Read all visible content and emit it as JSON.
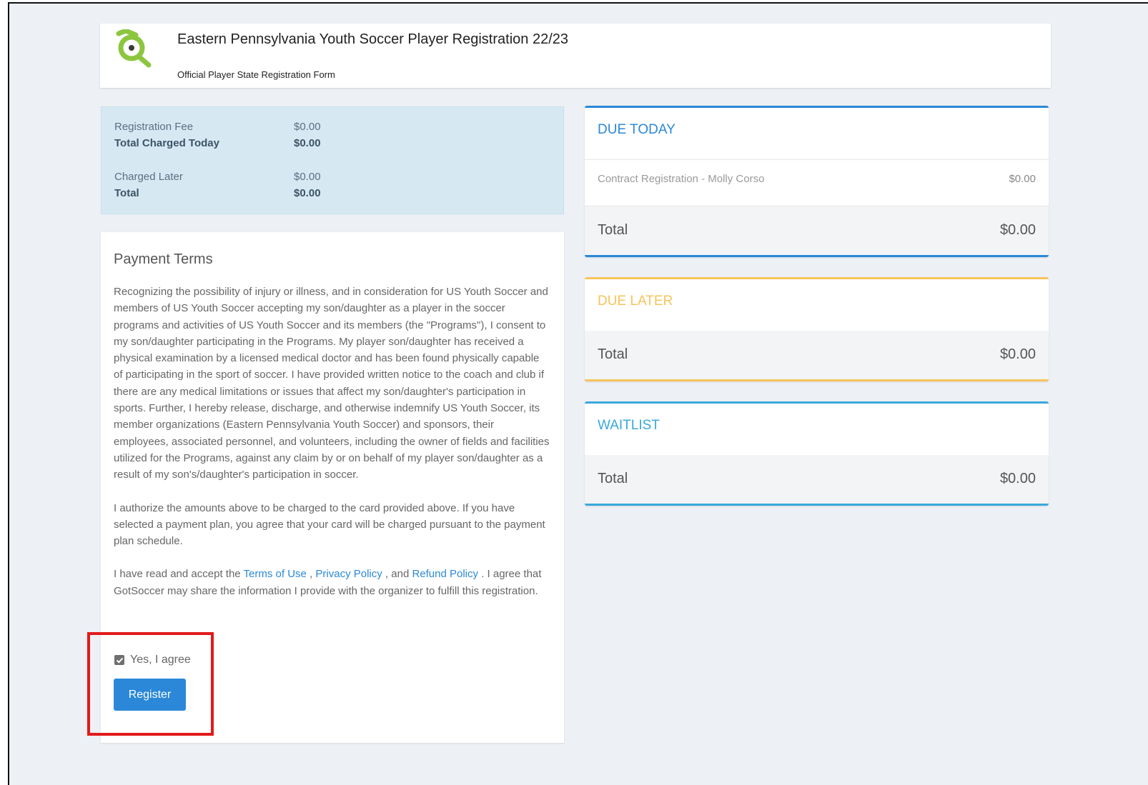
{
  "header": {
    "title": "Eastern Pennsylvania Youth Soccer Player Registration 22/23",
    "subtitle": "Official Player State Registration Form",
    "logo_icon": "gotsoccer-logo"
  },
  "summary": {
    "registration_fee_label": "Registration Fee",
    "registration_fee_value": "$0.00",
    "total_today_label": "Total Charged Today",
    "total_today_value": "$0.00",
    "charged_later_label": "Charged Later",
    "charged_later_value": "$0.00",
    "total_label": "Total",
    "total_value": "$0.00"
  },
  "terms": {
    "title": "Payment Terms",
    "paragraph1": "Recognizing the possibility of injury or illness, and in consideration for US Youth Soccer and members of US Youth Soccer accepting my son/daughter as a player in the soccer programs and activities of US Youth Soccer and its members (the \"Programs\"), I consent to my son/daughter participating in the Programs. My player son/daughter has received a physical examination by a licensed medical doctor and has been found physically capable of participating in the sport of soccer. I have provided written notice to the coach and club if there are any medical limitations or issues that affect my son/daughter's participation in sports. Further, I hereby release, discharge, and otherwise indemnify US Youth Soccer, its member organizations (Eastern Pennsylvania Youth Soccer) and sponsors, their employees, associated personnel, and volunteers, including the owner of fields and facilities utilized for the Programs, against any claim by or on behalf of my player son/daughter as a result of my son's/daughter's participation in soccer.",
    "paragraph2": "I authorize the amounts above to be charged to the card provided above. If you have selected a payment plan, you agree that your card will be charged pursuant to the payment plan schedule.",
    "p3_prefix": "I have read and accept the ",
    "terms_link": "Terms of Use",
    "sep1": " , ",
    "privacy_link": "Privacy Policy",
    "sep2": " , and ",
    "refund_link": "Refund Policy",
    "p3_suffix": " . I agree that GotSoccer may share the information I provide with the organizer to fulfill this registration.",
    "agree_label": "Yes, I agree",
    "agree_checked": true,
    "register_label": "Register"
  },
  "due_today": {
    "heading": "DUE TODAY",
    "color": "#2b88d8",
    "item_label": "Contract Registration - Molly Corso",
    "item_value": "$0.00",
    "total_label": "Total",
    "total_value": "$0.00"
  },
  "due_later": {
    "heading": "DUE LATER",
    "color": "#f7c45a",
    "total_label": "Total",
    "total_value": "$0.00"
  },
  "waitlist": {
    "heading": "WAITLIST",
    "color": "#3aa8dc",
    "total_label": "Total",
    "total_value": "$0.00"
  },
  "annotation": {
    "highlight_color": "#e21a1a"
  }
}
